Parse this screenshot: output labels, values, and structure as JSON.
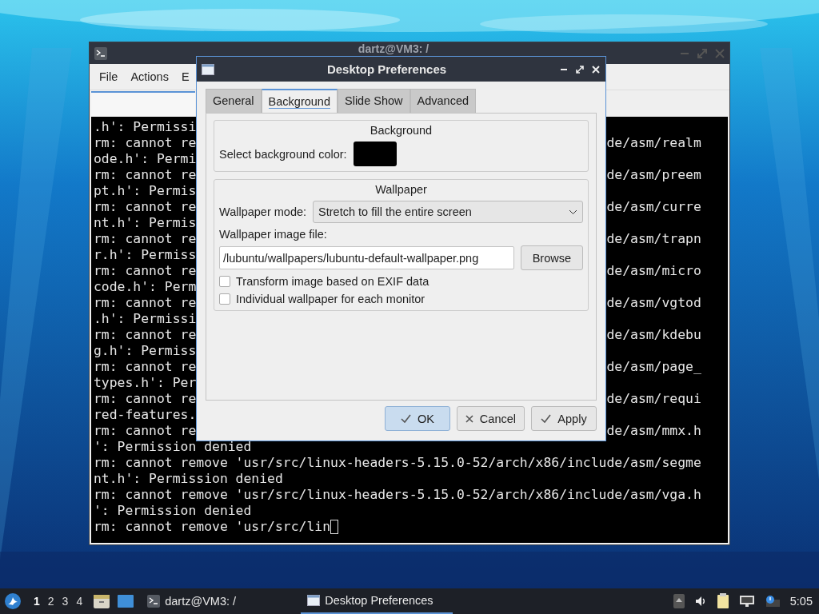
{
  "terminal": {
    "title": "dartz@VM3: /",
    "menu": [
      "File",
      "Actions",
      "E"
    ],
    "lines": [
      {
        "left": ".h': Permissi"
      },
      {
        "left": "rm: cannot re",
        "right": "de/asm/realm"
      },
      {
        "left": "ode.h': Permi"
      },
      {
        "left": "rm: cannot re",
        "right": "de/asm/preem"
      },
      {
        "left": "pt.h': Permis"
      },
      {
        "left": "rm: cannot re",
        "right": "de/asm/curre"
      },
      {
        "left": "nt.h': Permis"
      },
      {
        "left": "rm: cannot re",
        "right": "de/asm/trapn"
      },
      {
        "left": "r.h': Permiss"
      },
      {
        "left": "rm: cannot re",
        "right": "de/asm/micro"
      },
      {
        "left": "code.h': Perm"
      },
      {
        "left": "rm: cannot re",
        "right": "de/asm/vgtod"
      },
      {
        "left": ".h': Permissi"
      },
      {
        "left": "rm: cannot re",
        "right": "de/asm/kdebu"
      },
      {
        "left": "g.h': Permiss"
      },
      {
        "left": "rm: cannot re",
        "right": "de/asm/page_"
      },
      {
        "left": "types.h': Per"
      },
      {
        "left": "rm: cannot re",
        "right": "de/asm/requi"
      },
      {
        "left": "red-features."
      },
      {
        "left": "rm: cannot re",
        "right": "de/asm/mmx.h"
      },
      {
        "left": "': Permission denied"
      },
      {
        "left": "rm: cannot remove 'usr/src/linux-headers-5.15.0-52/arch/x86/include/asm/segme"
      },
      {
        "left": "nt.h': Permission denied"
      },
      {
        "left": "rm: cannot remove 'usr/src/linux-headers-5.15.0-52/arch/x86/include/asm/vga.h"
      },
      {
        "left": "': Permission denied"
      },
      {
        "left": "rm: cannot remove 'usr/src/lin"
      }
    ]
  },
  "dialog": {
    "title": "Desktop Preferences",
    "tabs": [
      {
        "label": "General",
        "selected": false
      },
      {
        "label": "Background",
        "selected": true
      },
      {
        "label": "Slide Show",
        "selected": false
      },
      {
        "label": "Advanced",
        "selected": false
      }
    ],
    "background_group": {
      "title": "Background",
      "color_label": "Select background color:",
      "color": "#000000"
    },
    "wallpaper_group": {
      "title": "Wallpaper",
      "mode_label": "Wallpaper mode:",
      "mode": "Stretch to fill the entire screen",
      "file_label": "Wallpaper image file:",
      "file": "/lubuntu/wallpapers/lubuntu-default-wallpaper.png",
      "browse": "Browse",
      "options": [
        {
          "label": "Transform image based on EXIF data",
          "checked": false
        },
        {
          "label": "Individual wallpaper for each monitor",
          "checked": false
        }
      ]
    },
    "buttons": [
      {
        "label": "OK",
        "kind": "confirm",
        "default": true
      },
      {
        "label": "Cancel",
        "kind": "cancel",
        "default": false
      },
      {
        "label": "Apply",
        "kind": "confirm",
        "default": false
      }
    ]
  },
  "taskbar": {
    "workspaces": [
      {
        "label": "1",
        "selected": true
      },
      {
        "label": "2",
        "selected": false
      },
      {
        "label": "3",
        "selected": false
      },
      {
        "label": "4",
        "selected": false
      }
    ],
    "tasks": [
      {
        "label": "dartz@VM3: /",
        "kind": "terminal",
        "selected": false
      },
      {
        "label": "Desktop Preferences",
        "kind": "window",
        "selected": true
      }
    ],
    "clock": "5:05"
  }
}
